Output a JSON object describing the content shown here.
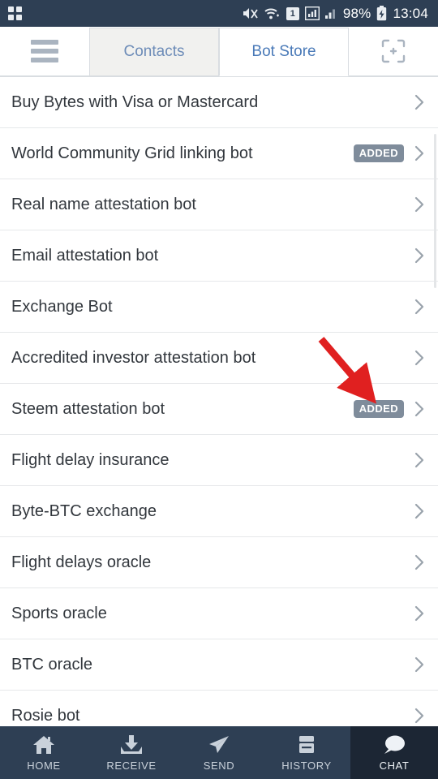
{
  "statusbar": {
    "left_icon": "apps-grid-icon",
    "icons": [
      "mute-icon",
      "wifi-icon",
      "sim-1-icon",
      "signal-icon",
      "signal-2-icon"
    ],
    "sim_label": "1",
    "battery_percent": "98%",
    "battery_icon": "battery-charging-icon",
    "time": "13:04"
  },
  "tabbar": {
    "menu_icon": "hamburger-menu-icon",
    "scan_icon": "qr-scan-icon",
    "tabs": [
      {
        "label": "Contacts",
        "active": false
      },
      {
        "label": "Bot Store",
        "active": true
      }
    ]
  },
  "bot_list": [
    {
      "label": "Buy Bytes with Visa or Mastercard",
      "badge": ""
    },
    {
      "label": "World Community Grid linking bot",
      "badge": "ADDED"
    },
    {
      "label": "Real name attestation bot",
      "badge": ""
    },
    {
      "label": "Email attestation bot",
      "badge": ""
    },
    {
      "label": "Exchange Bot",
      "badge": ""
    },
    {
      "label": "Accredited investor attestation bot",
      "badge": ""
    },
    {
      "label": "Steem attestation bot",
      "badge": "ADDED"
    },
    {
      "label": "Flight delay insurance",
      "badge": ""
    },
    {
      "label": "Byte-BTC exchange",
      "badge": ""
    },
    {
      "label": "Flight delays oracle",
      "badge": ""
    },
    {
      "label": "Sports oracle",
      "badge": ""
    },
    {
      "label": "BTC oracle",
      "badge": ""
    },
    {
      "label": "Rosie bot",
      "badge": ""
    }
  ],
  "annotation": {
    "type": "red-arrow",
    "color": "#e02020",
    "points_to": "Steem attestation bot ADDED badge"
  },
  "bottomnav": [
    {
      "label": "HOME",
      "icon": "home-icon",
      "active": false
    },
    {
      "label": "RECEIVE",
      "icon": "download-inbox-icon",
      "active": false
    },
    {
      "label": "SEND",
      "icon": "paper-plane-icon",
      "active": false
    },
    {
      "label": "HISTORY",
      "icon": "archive-box-icon",
      "active": false
    },
    {
      "label": "CHAT",
      "icon": "speech-bubble-icon",
      "active": true
    }
  ],
  "colors": {
    "chrome": "#2e3f54",
    "nav_active": "#1c2634",
    "tab_text": "#4a7ab8",
    "badge": "#7f8c9b",
    "accent_red": "#e02020"
  }
}
